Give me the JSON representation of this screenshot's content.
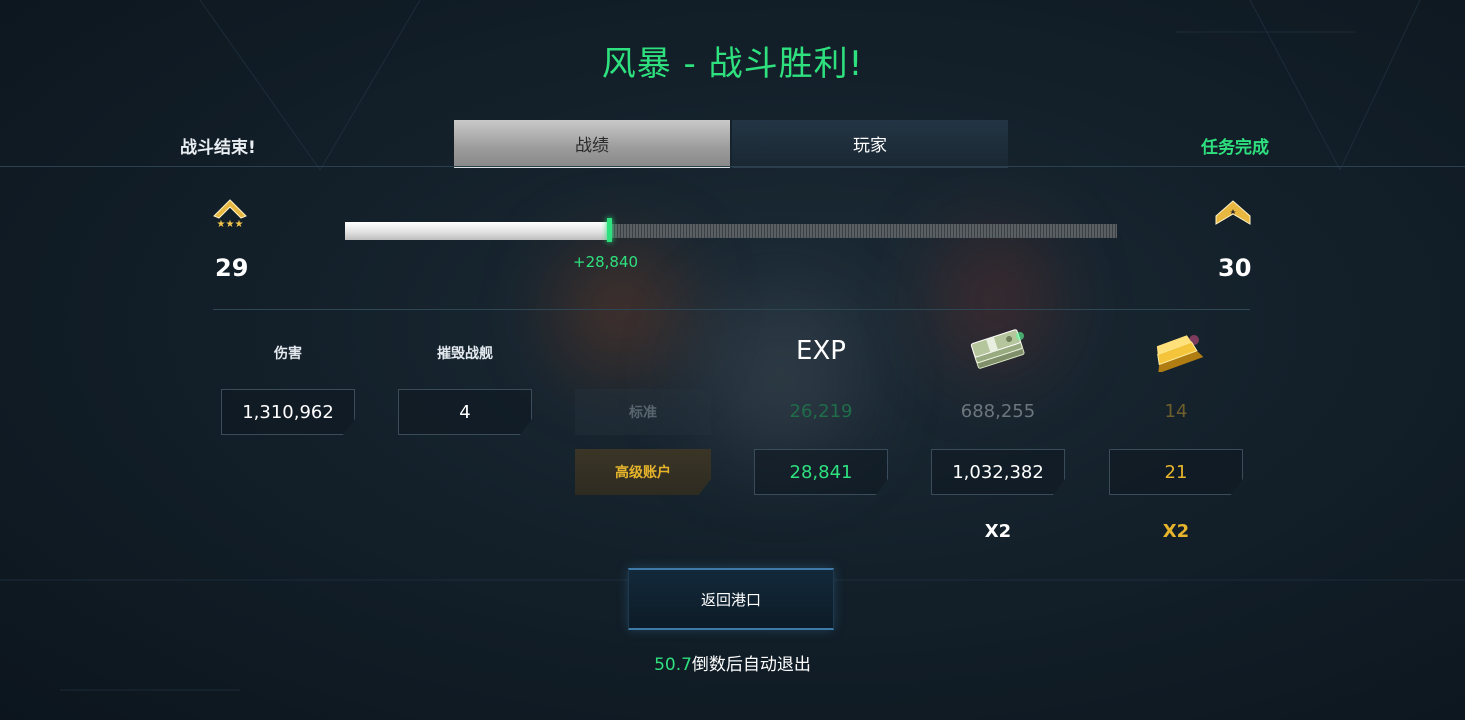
{
  "header": {
    "title": "风暴 - 战斗胜利!",
    "left_label": "战斗结束!",
    "right_label": "任务完成"
  },
  "tabs": [
    {
      "label": "战绩",
      "active": true
    },
    {
      "label": "玩家",
      "active": false
    }
  ],
  "progress": {
    "rank_current": "29",
    "rank_next": "30",
    "exp_gain": "+28,840",
    "fill_fraction": 0.34,
    "rank_current_icon": "rank-chevron-three-stars-icon",
    "rank_next_icon": "rank-chevron-star-icon"
  },
  "stats": {
    "damage_label": "伤害",
    "damage_value": "1,310,962",
    "destroyed_label": "摧毁战舰",
    "destroyed_value": "4"
  },
  "rewards": {
    "exp_label": "EXP",
    "credits_icon": "cash-stack-icon",
    "gold_icon": "gold-bar-icon",
    "standard_label": "标准",
    "premium_label": "高级账户",
    "standard": {
      "exp": "26,219",
      "credits": "688,255",
      "gold": "14"
    },
    "premium": {
      "exp": "28,841",
      "credits": "1,032,382",
      "gold": "21"
    },
    "credits_multiplier": "X2",
    "gold_multiplier": "X2"
  },
  "footer": {
    "return_button": "返回港口",
    "countdown_value": "50.7",
    "countdown_text": "倒数后自动退出"
  },
  "colors": {
    "accent_green": "#2ee07e",
    "gold": "#e6b52c",
    "background": "#13202a"
  }
}
